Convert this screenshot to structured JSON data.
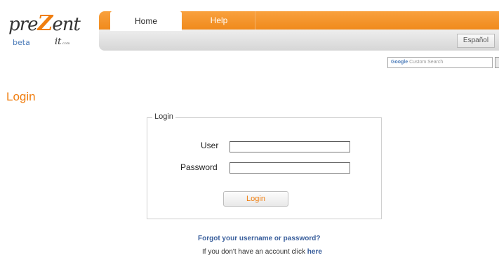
{
  "logo": {
    "main_prefix": "pre",
    "main_z": "Z",
    "main_suffix": "ent",
    "beta": "beta",
    "it": "it",
    "it_small": ".com"
  },
  "nav": {
    "tabs": [
      {
        "label": "Home",
        "active": true
      },
      {
        "label": "Help",
        "active": false
      }
    ],
    "language_button": "Español"
  },
  "search": {
    "google_text": "Google",
    "placeholder": "Custom Search"
  },
  "page": {
    "title": "Login"
  },
  "login_form": {
    "legend": "Login",
    "user_label": "User",
    "user_value": "",
    "password_label": "Password",
    "password_value": "",
    "submit_label": "Login"
  },
  "footer": {
    "forgot_link": "Forgot your username or password?",
    "account_prefix": "If you don't have an account click ",
    "account_link": "here"
  },
  "colors": {
    "accent": "#f07e10",
    "link": "#3a5f9c"
  }
}
